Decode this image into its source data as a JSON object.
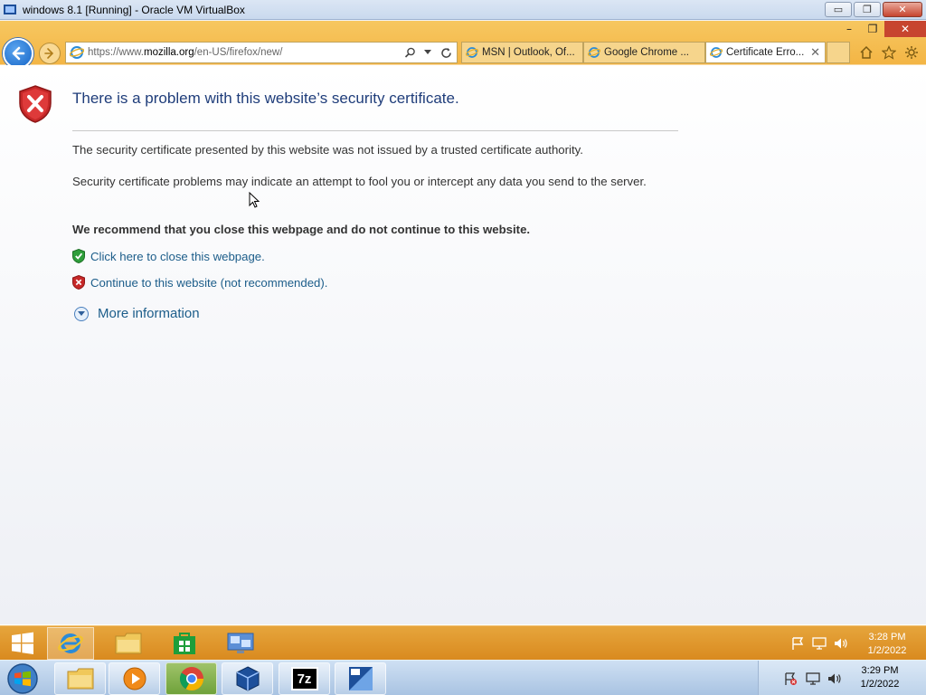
{
  "host_window": {
    "title": "windows 8.1 [Running] - Oracle VM VirtualBox",
    "minimize_glyph": "▭",
    "restore_glyph": "❐",
    "close_glyph": "✕"
  },
  "guest_window": {
    "minimize_glyph": "–",
    "restore_glyph": "❐",
    "close_glyph": "✕"
  },
  "browser": {
    "address": {
      "prefix": "https://www.",
      "domain": "mozilla.org",
      "suffix": "/en-US/firefox/new/"
    },
    "tabs": [
      {
        "label": "MSN | Outlook, Of...",
        "active": false
      },
      {
        "label": "Google Chrome ...",
        "active": false
      },
      {
        "label": "Certificate Erro...",
        "active": true,
        "close": "✕"
      }
    ]
  },
  "page": {
    "title": "There is a problem with this website’s security certificate.",
    "paragraph1": "The security certificate presented by this website was not issued by a trusted certificate authority.",
    "paragraph2": "Security certificate problems may indicate an attempt to fool you or intercept any data you send to the server.",
    "recommendation": "We recommend that you close this webpage and do not continue to this website.",
    "close_link": "Click here to close this webpage.",
    "continue_link": "Continue to this website (not recommended).",
    "more_info": "More information"
  },
  "guest_taskbar": {
    "clock_time": "3:28 PM",
    "clock_date": "1/2/2022"
  },
  "host_taskbar": {
    "clock_time": "3:29 PM",
    "clock_date": "1/2/2022",
    "sevenzip_label": "7z"
  },
  "colors": {
    "accent_title": "#1f3d7a",
    "link": "#1c5d8a",
    "ie_chrome": "#f3b545",
    "error_red": "#c62828"
  }
}
